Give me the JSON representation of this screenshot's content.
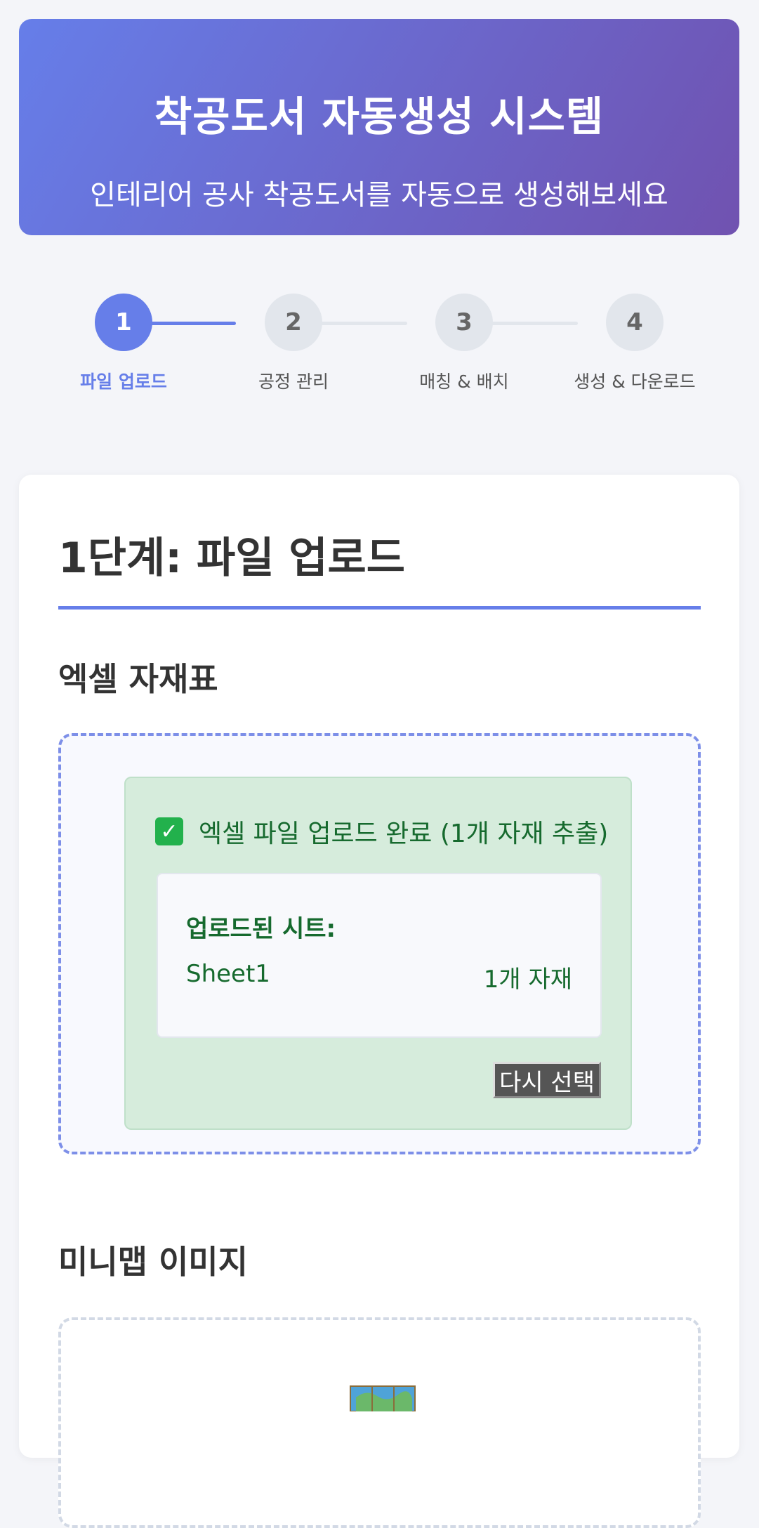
{
  "header": {
    "title": "착공도서 자동생성 시스템",
    "subtitle": "인테리어 공사 착공도서를 자동으로 생성해보세요"
  },
  "steps": [
    {
      "number": "1",
      "label": "파일 업로드",
      "active": true
    },
    {
      "number": "2",
      "label": "공정 관리",
      "active": false
    },
    {
      "number": "3",
      "label": "매칭 & 배치",
      "active": false
    },
    {
      "number": "4",
      "label": "생성 & 다운로드",
      "active": false
    }
  ],
  "main": {
    "title": "1단계: 파일 업로드",
    "excel_section": {
      "title": "엑셀 자재표",
      "success_message": "엑셀 파일 업로드 완료 (1개 자재 추출)",
      "uploaded_sheets_label": "업로드된 시트:",
      "sheets": [
        {
          "name": "Sheet1",
          "count": "1개 자재"
        }
      ],
      "reselect_label": "다시 선택"
    },
    "minimap_section": {
      "title": "미니맵 이미지",
      "icon": "map-icon"
    }
  },
  "colors": {
    "accent": "#667ee9",
    "header_gradient_start": "#667ee9",
    "header_gradient_end": "#7052b0",
    "success_text": "#166a2e",
    "success_bg": "#d6ecdc"
  }
}
